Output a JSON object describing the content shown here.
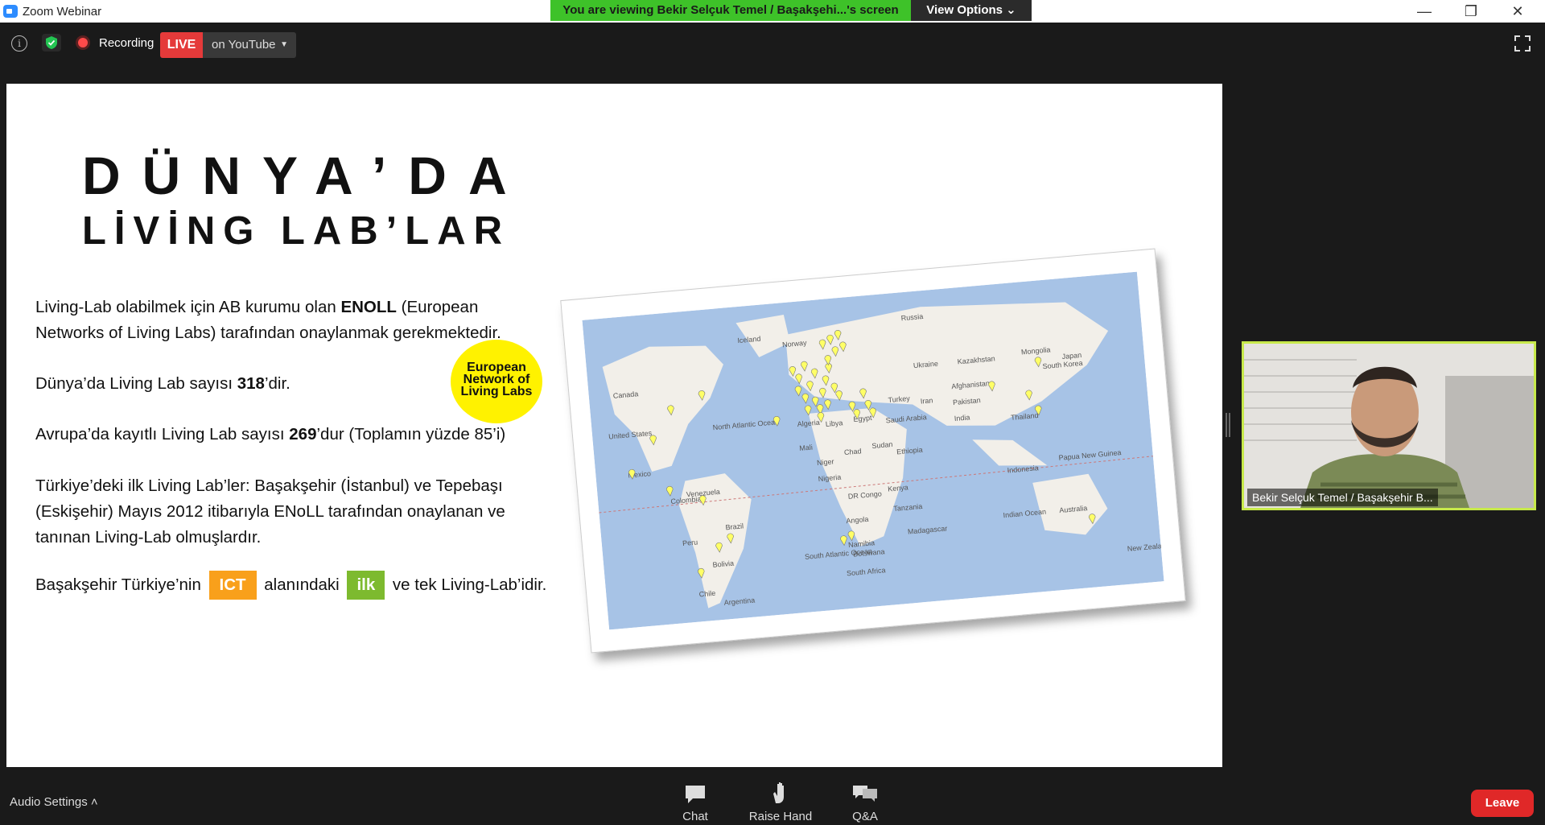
{
  "window": {
    "title": "Zoom Webinar",
    "banner": "You are viewing Bekir Selçuk Temel / Başakşehi...'s screen",
    "view_options": "View Options ⌄",
    "minimize": "—",
    "restore": "❐",
    "close": "✕"
  },
  "topbar": {
    "recording_label": "Recording",
    "live_label": "LIVE",
    "youtube_label": "on YouTube",
    "info_glyph": "i"
  },
  "slide": {
    "title_line1": "DÜNYA’DA",
    "title_line2": "LİVİNG LAB’LAR",
    "p1_pre": "Living-Lab olabilmek için AB kurumu olan ",
    "p1_bold": "ENOLL",
    "p1_post": " (European",
    "p1_line2": "Networks of Living Labs) tarafından onaylanmak gerekmektedir.",
    "p2_pre": "Dünya’da Living Lab sayısı ",
    "p2_bold": "318",
    "p2_post": "’dir.",
    "p3_pre": "Avrupa’da kayıtlı Living Lab sayısı ",
    "p3_bold": "269",
    "p3_post": "’dur (Toplamın yüzde 85’i)",
    "p4_line1": "Türkiye’deki ilk Living Lab’ler: Başakşehir (İstanbul) ve Tepebaşı",
    "p4_line2": "(Eskişehir) Mayıs 2012 itibarıyla ENoLL tarafından onaylanan ve",
    "p4_line3": "tanınan Living-Lab olmuşlardır.",
    "p5_pre": "Başakşehir Türkiye’nin ",
    "p5_hl1": "ICT",
    "p5_mid": " alanındaki ",
    "p5_hl2": "ilk",
    "p5_post": " ve  tek Living-Lab’idir.",
    "logo_line1": "European",
    "logo_line2": "Network of",
    "logo_line3": "Living Labs"
  },
  "map": {
    "labels": [
      "Iceland",
      "Norway",
      "Russia",
      "Kazakhstan",
      "Mongolia",
      "Ukraine",
      "Canada",
      "United States",
      "North Atlantic Ocean",
      "Turkey",
      "Iran",
      "Afghanistan",
      "Pakistan",
      "South Korea",
      "Japan",
      "Algeria",
      "Libya",
      "Egypt",
      "Saudi Arabia",
      "India",
      "Thailand",
      "Mexico",
      "Mali",
      "Niger",
      "Chad",
      "Sudan",
      "Ethiopia",
      "Venezuela",
      "Colombia",
      "Nigeria",
      "DR Congo",
      "Kenya",
      "Indonesia",
      "Papua New Guinea",
      "Peru",
      "Brazil",
      "Angola",
      "Tanzania",
      "Bolivia",
      "Namibia",
      "Botswana",
      "Madagascar",
      "Indian Ocean",
      "Australia",
      "South Atlantic Ocean",
      "Chile",
      "South Africa",
      "Argentina",
      "New Zealand"
    ]
  },
  "video": {
    "name": "Bekir Selçuk Temel / Başakşehir B..."
  },
  "bottombar": {
    "audio_settings": "Audio Settings  ˄",
    "chat": "Chat",
    "raise_hand": "Raise Hand",
    "qa": "Q&A",
    "leave": "Leave"
  },
  "colors": {
    "banner_green": "#3ec229",
    "live_red": "#e53a3a",
    "leave_red": "#e02828",
    "ict_orange": "#f9a01b",
    "ilk_green": "#7dba2f",
    "enoll_yellow": "#fff200",
    "active_speaker_border": "#c7e94b"
  }
}
